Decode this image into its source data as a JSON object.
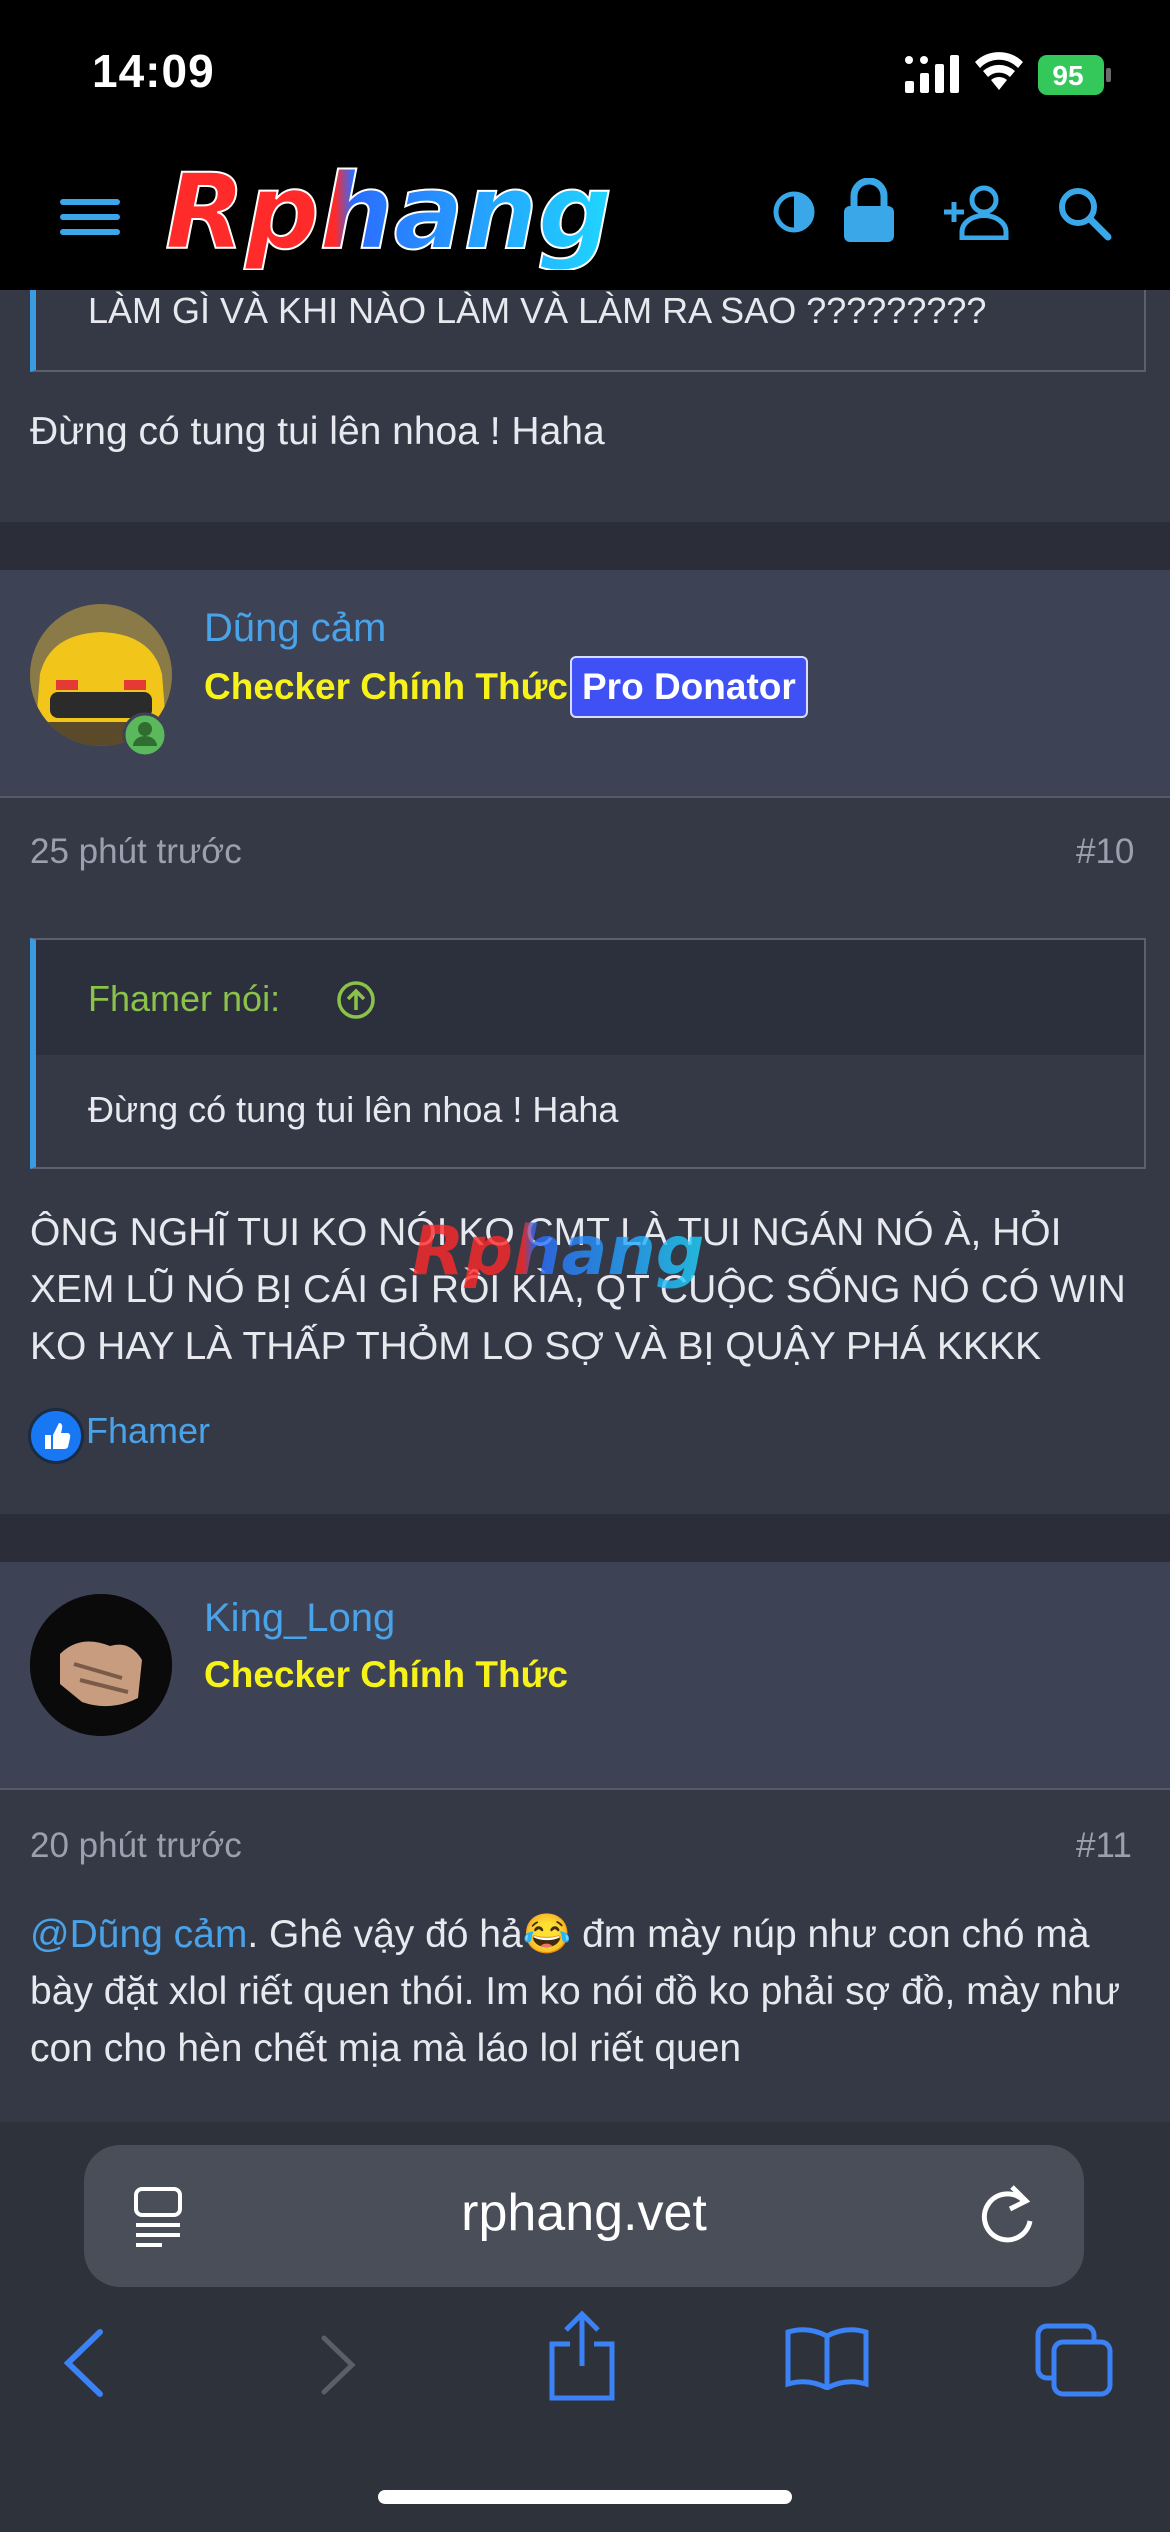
{
  "status_bar": {
    "time": "14:09",
    "battery": "95"
  },
  "site": {
    "logo_text": "Rphang",
    "watermark": "Rphang"
  },
  "previous_post": {
    "quote_tail": "LÀM GÌ VÀ KHI NÀO LÀM VÀ LÀM RA SAO ?????????",
    "text": "Đừng có tung tui lên nhoa ! Haha"
  },
  "posts": [
    {
      "username": "Dũng cảm",
      "user_title": "Checker Chính Thức",
      "badge": "Pro Donator",
      "time": "25 phút trước",
      "number": "#10",
      "quote_author": "Fhamer nói:",
      "quote_text": "Đừng có tung tui lên nhoa ! Haha",
      "text": "ÔNG NGHĨ TUI KO NÓI KO CMT LÀ TUI NGÁN NÓ À, HỎI XEM LŨ NÓ BỊ CÁI GÌ RỒI KÌA, QT CUỘC SỐNG NÓ CÓ WIN KO HAY LÀ THẤP THỎM LO SỢ VÀ BỊ QUẬY PHÁ KKKK",
      "reaction_user": "Fhamer"
    },
    {
      "username": "King_Long",
      "user_title": "Checker Chính Thức",
      "time": "20 phút trước",
      "number": "#11",
      "mention": "@Dũng cảm",
      "text_after_mention": ". Ghê vậy đó hả",
      "emoji": "😂",
      "text_rest": " đm mày núp như con chó mà bày đặt xlol riết quen thói. Im ko nói đồ ko phải sợ đồ, mày như con cho hèn chết mịa mà láo lol riết quen"
    }
  ],
  "browser": {
    "url": "rphang.vet"
  },
  "icons": {
    "menu": "hamburger-menu-icon",
    "theme": "contrast-icon",
    "lock": "lock-icon",
    "register": "add-user-icon",
    "search": "search-icon",
    "reader": "reader-icon",
    "reload": "reload-icon",
    "back": "chevron-left-icon",
    "forward": "chevron-right-icon",
    "share": "share-icon",
    "bookmarks": "book-icon",
    "tabs": "tabs-icon"
  },
  "colors": {
    "accent_blue": "#4aa3e8",
    "title_yellow": "#f7f21a",
    "badge_bg": "#3f51f5",
    "quote_green": "#8bc34a"
  }
}
